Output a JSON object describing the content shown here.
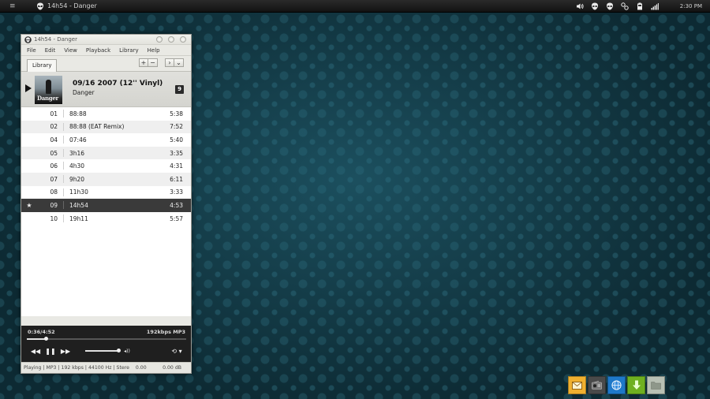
{
  "top_panel": {
    "menu_glyph": "≡",
    "window_title": "14h54 - Danger",
    "clock": "2:30 PM",
    "icons": [
      "volume-icon",
      "alien-icon",
      "alien-icon",
      "network-icon",
      "battery-icon",
      "signal-icon"
    ]
  },
  "window": {
    "title": "14h54 - Danger",
    "menu": [
      "File",
      "Edit",
      "View",
      "Playback",
      "Library",
      "Help"
    ],
    "tab_label": "Library",
    "toolbar_buttons": [
      "+",
      "−",
      "›",
      "⌄"
    ]
  },
  "album": {
    "title": "09/16 2007 (12'' Vinyl)",
    "artist": "Danger",
    "track_count": "9",
    "art_text": "Danger"
  },
  "tracks": [
    {
      "num": "01",
      "name": "88:88",
      "duration": "5:38",
      "star": ""
    },
    {
      "num": "02",
      "name": "88:88 (EAT Remix)",
      "duration": "7:52",
      "star": ""
    },
    {
      "num": "04",
      "name": "07:46",
      "duration": "5:40",
      "star": ""
    },
    {
      "num": "05",
      "name": "3h16",
      "duration": "3:35",
      "star": ""
    },
    {
      "num": "06",
      "name": "4h30",
      "duration": "4:31",
      "star": ""
    },
    {
      "num": "07",
      "name": "9h20",
      "duration": "6:11",
      "star": ""
    },
    {
      "num": "08",
      "name": "11h30",
      "duration": "3:33",
      "star": ""
    },
    {
      "num": "09",
      "name": "14h54",
      "duration": "4:53",
      "star": "★"
    },
    {
      "num": "10",
      "name": "19h11",
      "duration": "5:57",
      "star": ""
    }
  ],
  "playing_index": 7,
  "player": {
    "time": "0:36/4:52",
    "bitrate": "192kbps MP3",
    "progress": 0.12,
    "volume": 1.0,
    "rewind_glyph": "◀◀",
    "pause_glyph": "❚❚",
    "forward_glyph": "▶▶",
    "speaker_glyph": "◂))",
    "repeat_glyph": "⟲ ▾"
  },
  "statusbar": {
    "left": "Playing | MP3 | 192 kbps | 44100 Hz | Stere",
    "elapsed": "0.00",
    "gain": "0.00 dB"
  },
  "dock": [
    {
      "name": "mail-icon",
      "color": "#f0b030"
    },
    {
      "name": "radio-icon",
      "color": "#4a4a4a"
    },
    {
      "name": "globe-icon",
      "color": "#1e78c8"
    },
    {
      "name": "download-icon",
      "color": "#6fb020"
    },
    {
      "name": "folder-icon",
      "color": "#b8c0b4"
    }
  ]
}
